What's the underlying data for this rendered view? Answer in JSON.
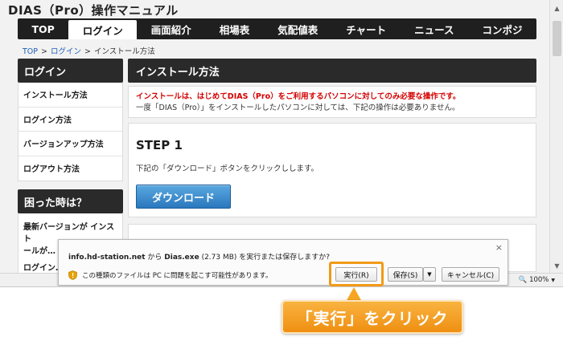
{
  "site": {
    "title": "DIAS（Pro）操作マニュアル"
  },
  "nav": {
    "items": [
      "TOP",
      "ログイン",
      "画面紹介",
      "相場表",
      "気配値表",
      "チャート",
      "ニュース",
      "コンポジ"
    ],
    "active": "ログイン"
  },
  "breadcrumb": {
    "top": "TOP",
    "login": "ログイン",
    "current": "インストール方法",
    "sep": ">"
  },
  "sidebar": {
    "heading": "ログイン",
    "items": [
      "インストール方法",
      "ログイン方法",
      "バージョンアップ方法",
      "ログアウト方法"
    ],
    "heading2": "困った時は？",
    "item2_line1": "最新バージョンが インスト",
    "item2_line2": "ールが…",
    "item2_line3": "ログイン…"
  },
  "main": {
    "heading": "インストール方法",
    "notice_red": "インストールは、はじめてDIAS（Pro）をご利用するパソコンに対してのみ必要な操作です。",
    "notice_plain": "一度「DIAS（Pro）」をインストールしたパソコンに対しては、下記の操作は必要ありません。",
    "step_title": "STEP 1",
    "step_text": "下記の「ダウンロード」ボタンをクリックしします。",
    "download_button": "ダウンロード"
  },
  "download_bar": {
    "host": "info.hd-station.net",
    "from": " から ",
    "file": "Dias.exe",
    "size": " (2.73 MB) を実行または保存しますか?",
    "warning": "この種類のファイルは PC に問題を起こす可能性があります。",
    "run": "実行(R)",
    "save": "保存(S)",
    "cancel": "キャンセル(C)",
    "close": "×",
    "save_arrow": "▼"
  },
  "status": {
    "zoom": "100%"
  },
  "callout": {
    "text": "「実行」をクリック"
  },
  "colors": {
    "accent_orange": "#f29a16",
    "nav_dark": "#1f1f1f",
    "notice_red": "#d40000",
    "button_blue": "#2a78bd"
  },
  "icons": [
    "shield-warning-icon",
    "close-icon",
    "zoom-icon",
    "chevron-down-icon"
  ]
}
